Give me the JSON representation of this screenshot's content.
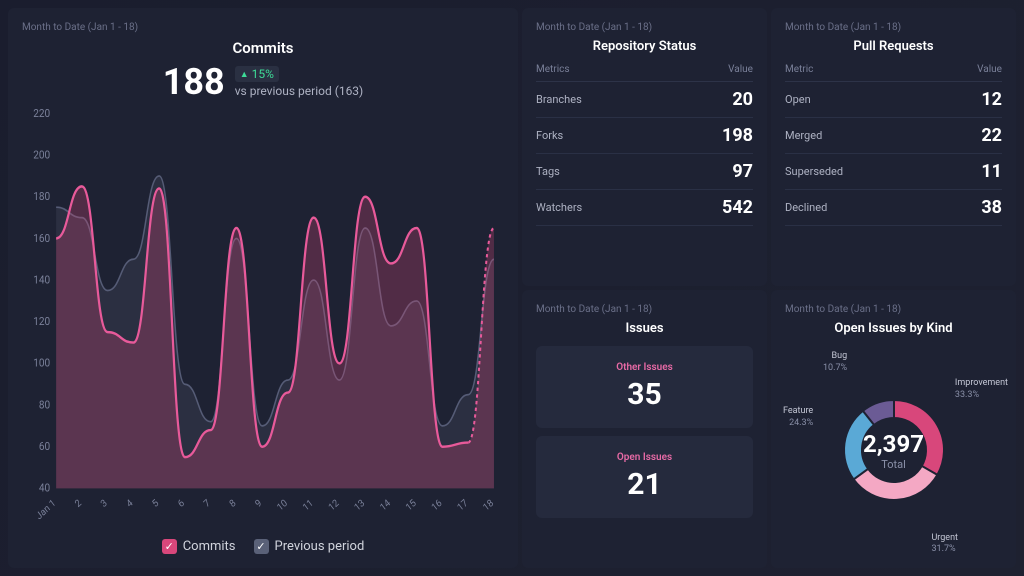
{
  "period_label": "Month to Date (Jan 1 - 18)",
  "commits": {
    "title": "Commits",
    "value": "188",
    "delta": "15%",
    "subtitle": "vs previous period (163)",
    "legend_commits": "Commits",
    "legend_prev": "Previous period"
  },
  "repo_status": {
    "title": "Repository Status",
    "col_metric": "Metrics",
    "col_value": "Value",
    "rows": [
      {
        "label": "Branches",
        "value": "20"
      },
      {
        "label": "Forks",
        "value": "198"
      },
      {
        "label": "Tags",
        "value": "97"
      },
      {
        "label": "Watchers",
        "value": "542"
      }
    ]
  },
  "pull_requests": {
    "title": "Pull Requests",
    "col_metric": "Metric",
    "col_value": "Value",
    "rows": [
      {
        "label": "Open",
        "value": "12"
      },
      {
        "label": "Merged",
        "value": "22"
      },
      {
        "label": "Superseded",
        "value": "11"
      },
      {
        "label": "Declined",
        "value": "38"
      }
    ]
  },
  "issues": {
    "title": "Issues",
    "other_label": "Other Issues",
    "other_value": "35",
    "open_label": "Open Issues",
    "open_value": "21"
  },
  "open_issues_kind": {
    "title": "Open Issues by Kind",
    "total_value": "2,397",
    "total_label": "Total",
    "slices": [
      {
        "name": "Bug",
        "pct": "10.7%"
      },
      {
        "name": "Improvement",
        "pct": "33.3%"
      },
      {
        "name": "Feature",
        "pct": "24.3%"
      },
      {
        "name": "Urgent",
        "pct": "31.7%"
      }
    ]
  },
  "chart_data": {
    "type": "line",
    "title": "Commits",
    "xlabel": "",
    "ylabel": "",
    "ylim": [
      40,
      220
    ],
    "x": [
      "Jan 1",
      "2",
      "3",
      "4",
      "5",
      "6",
      "7",
      "8",
      "9",
      "10",
      "11",
      "12",
      "13",
      "14",
      "15",
      "16",
      "17",
      "18"
    ],
    "series": [
      {
        "name": "Commits",
        "color": "#d8477b",
        "values": [
          160,
          185,
          115,
          110,
          184,
          55,
          68,
          165,
          60,
          86,
          170,
          100,
          180,
          148,
          165,
          60,
          62,
          165
        ]
      },
      {
        "name": "Previous period",
        "color": "#5a6178",
        "values": [
          175,
          170,
          135,
          150,
          190,
          90,
          72,
          160,
          70,
          92,
          140,
          92,
          165,
          118,
          130,
          70,
          85,
          150
        ]
      }
    ]
  }
}
